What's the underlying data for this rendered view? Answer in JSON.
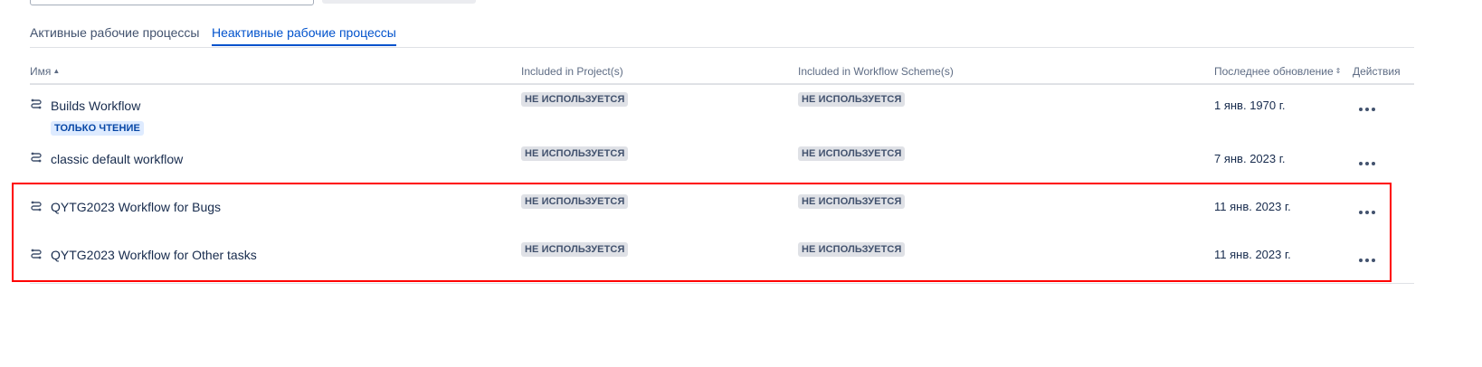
{
  "tabs": [
    {
      "label": "Активные рабочие процессы",
      "active": false
    },
    {
      "label": "Неактивные рабочие процессы",
      "active": true
    }
  ],
  "table": {
    "columns": {
      "name": "Имя",
      "projects": "Included in Project(s)",
      "schemes": "Included in Workflow Scheme(s)",
      "updated": "Последнее обновление",
      "actions": "Действия"
    },
    "rows": [
      {
        "name": "Builds Workflow",
        "badge": "ТОЛЬКО ЧТЕНИЕ",
        "projects": "НЕ ИСПОЛЬЗУЕТСЯ",
        "schemes": "НЕ ИСПОЛЬЗУЕТСЯ",
        "updated": "1 янв. 1970 г."
      },
      {
        "name": "classic default workflow",
        "projects": "НЕ ИСПОЛЬЗУЕТСЯ",
        "schemes": "НЕ ИСПОЛЬЗУЕТСЯ",
        "updated": "7 янв. 2023 г."
      },
      {
        "name": "QYTG2023 Workflow for Bugs",
        "projects": "НЕ ИСПОЛЬЗУЕТСЯ",
        "schemes": "НЕ ИСПОЛЬЗУЕТСЯ",
        "updated": "11 янв. 2023 г."
      },
      {
        "name": "QYTG2023 Workflow for Other tasks",
        "projects": "НЕ ИСПОЛЬЗУЕТСЯ",
        "schemes": "НЕ ИСПОЛЬЗУЕТСЯ",
        "updated": "11 янв. 2023 г."
      }
    ]
  },
  "colors": {
    "accent": "#0052cc",
    "highlight": "#ff0000",
    "lozenge_bg": "#dfe1e6",
    "readonly_bg": "#deebff"
  },
  "icons": {
    "workflow": "workflow-icon",
    "more": "more-actions-icon",
    "sort": "sort-icon"
  }
}
